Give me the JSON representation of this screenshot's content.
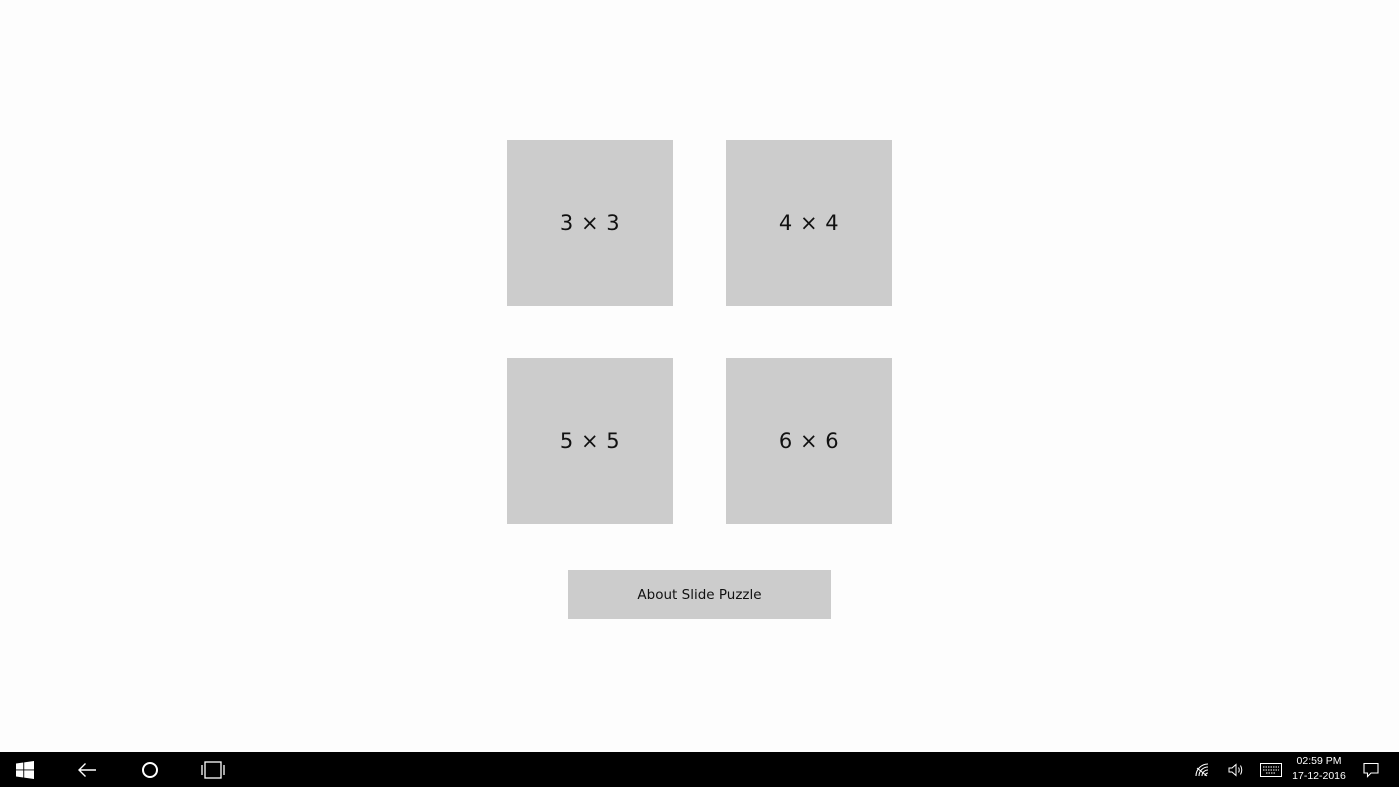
{
  "app": {
    "tiles": [
      {
        "label": "3 × 3"
      },
      {
        "label": "4 × 4"
      },
      {
        "label": "5 × 5"
      },
      {
        "label": "6 × 6"
      }
    ],
    "about_label": "About Slide Puzzle"
  },
  "taskbar": {
    "start_icon": "windows-logo-icon",
    "back_icon": "back-arrow-icon",
    "search_icon": "cortana-circle-icon",
    "taskview_icon": "task-view-icon",
    "tray": {
      "network_icon": "network-icon",
      "volume_icon": "volume-icon",
      "keyboard_icon": "touch-keyboard-icon",
      "notify_icon": "action-center-icon"
    },
    "clock": {
      "time": "02:59 PM",
      "date": "17-12-2016"
    }
  },
  "colors": {
    "tile": "#cccccc",
    "background": "#fdfdfd",
    "taskbar": "#000000"
  }
}
